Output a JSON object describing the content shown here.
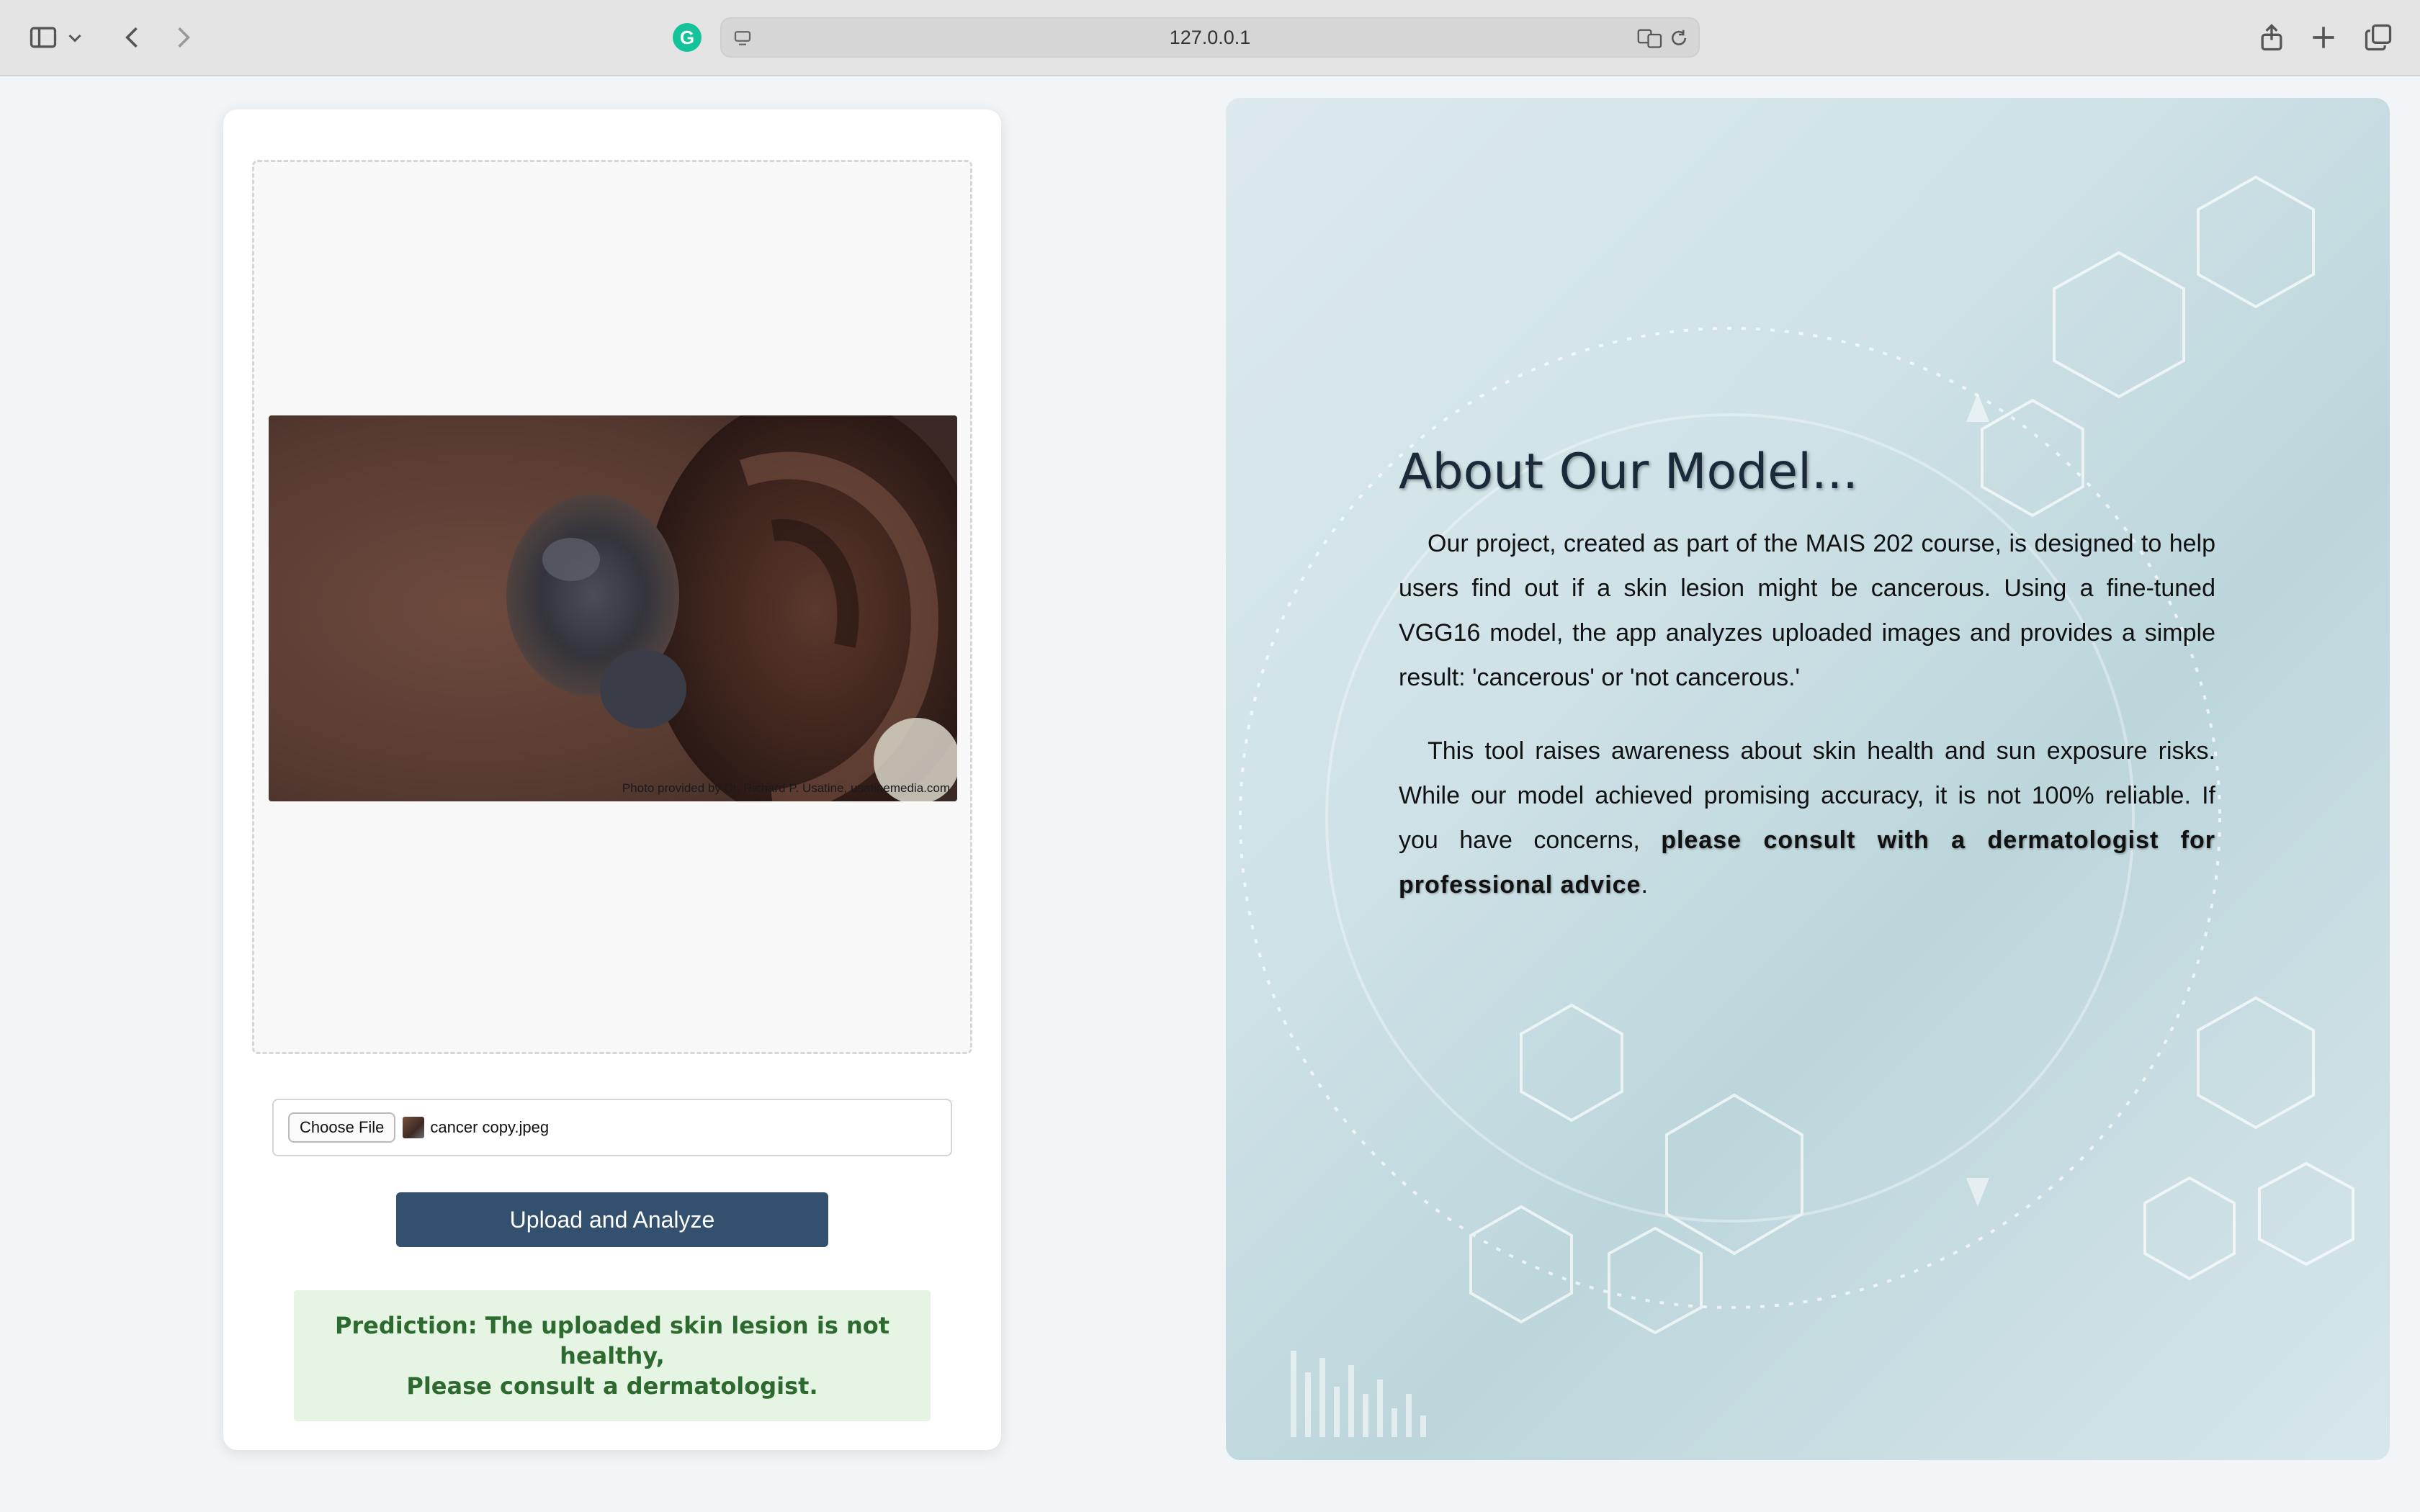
{
  "browser": {
    "url": "127.0.0.1",
    "grammarly_letter": "G"
  },
  "upload": {
    "image_credit": "Photo provided by Dr. Richard P. Usatine, usatinemedia.com",
    "choose_file_label": "Choose File",
    "file_name": "cancer copy.jpeg",
    "upload_button": "Upload and Analyze",
    "prediction_line1": "Prediction: The uploaded skin lesion is not healthy,",
    "prediction_line2": "Please consult a dermatologist."
  },
  "about": {
    "title": "About Our Model...",
    "paragraph1": "Our project, created as part of the MAIS 202 course, is designed to help users find out if a skin lesion might be cancerous. Using a fine-tuned VGG16 model, the app analyzes uploaded images and provides a simple result: 'cancerous' or 'not cancerous.'",
    "paragraph2_lead": "This tool raises awareness about skin health and sun exposure risks. While our model achieved promising accuracy, it is not 100% reliable. If you have concerns, ",
    "paragraph2_emphasis": "please consult with a dermatologist for professional advice",
    "paragraph2_end": "."
  },
  "colors": {
    "upload_button": "#34506f",
    "prediction_bg": "#e6f4e4",
    "prediction_text": "#2d6a2f"
  }
}
